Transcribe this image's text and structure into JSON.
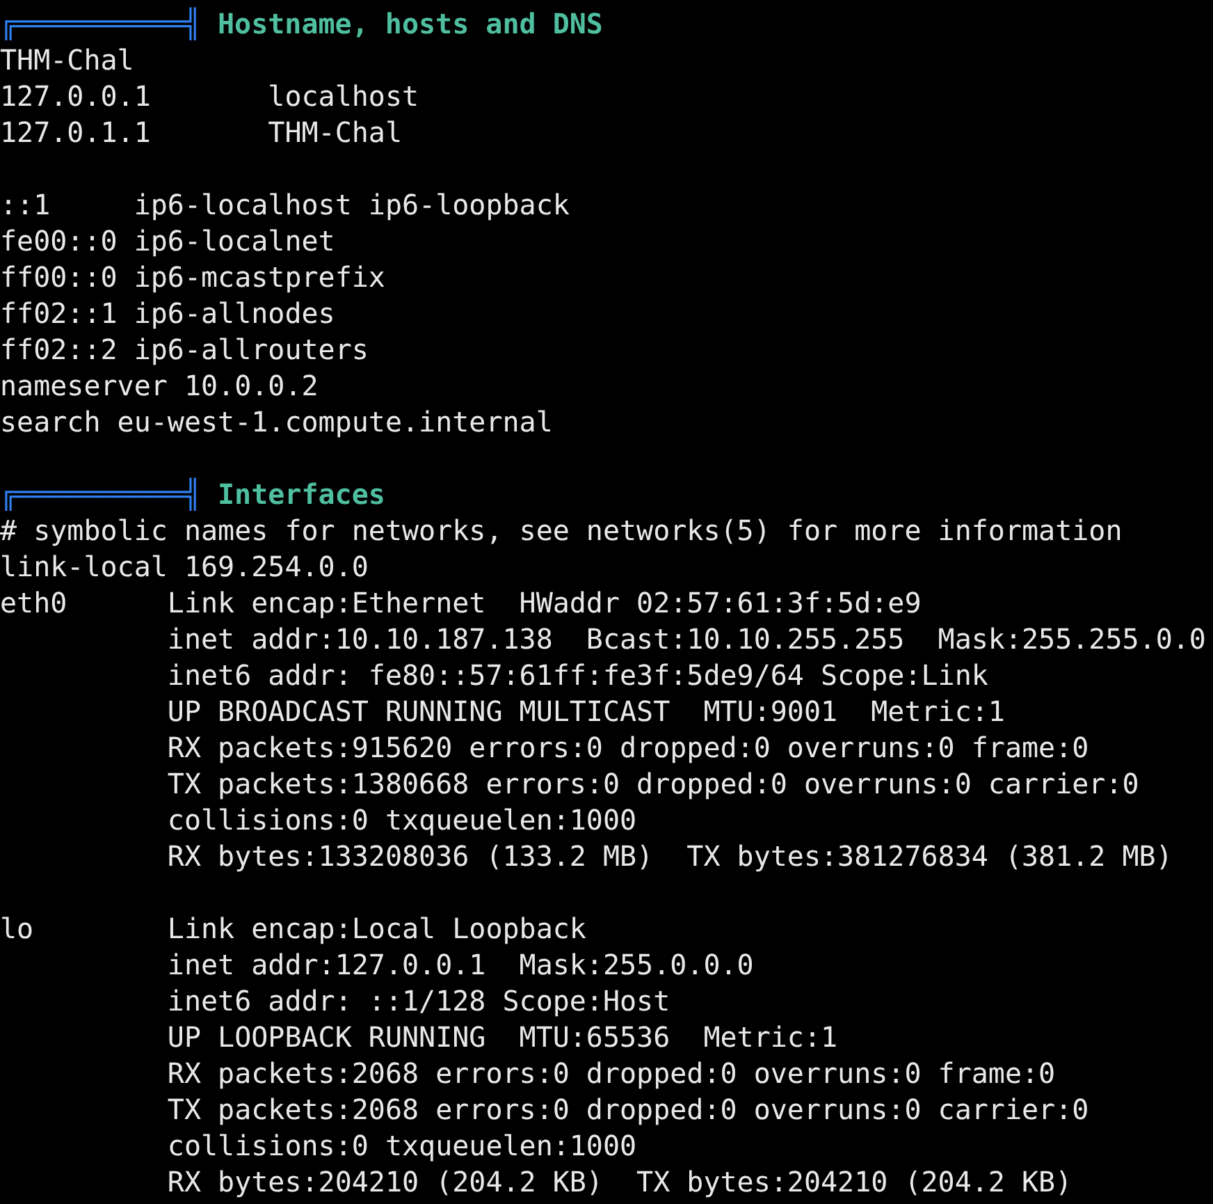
{
  "sections": [
    {
      "rule": "╔══════════╣",
      "title": "Hostname, hosts and DNS",
      "blocks": [
        [
          "THM-Chal",
          "127.0.0.1       localhost",
          "127.0.1.1       THM-Chal"
        ],
        [
          "::1     ip6-localhost ip6-loopback",
          "fe00::0 ip6-localnet",
          "ff00::0 ip6-mcastprefix",
          "ff02::1 ip6-allnodes",
          "ff02::2 ip6-allrouters",
          "nameserver 10.0.0.2",
          "search eu-west-1.compute.internal"
        ]
      ]
    },
    {
      "rule": "╔══════════╣",
      "title": "Interfaces",
      "blocks": [
        [
          "# symbolic names for networks, see networks(5) for more information",
          "link-local 169.254.0.0",
          "eth0      Link encap:Ethernet  HWaddr 02:57:61:3f:5d:e9",
          "          inet addr:10.10.187.138  Bcast:10.10.255.255  Mask:255.255.0.0",
          "          inet6 addr: fe80::57:61ff:fe3f:5de9/64 Scope:Link",
          "          UP BROADCAST RUNNING MULTICAST  MTU:9001  Metric:1",
          "          RX packets:915620 errors:0 dropped:0 overruns:0 frame:0",
          "          TX packets:1380668 errors:0 dropped:0 overruns:0 carrier:0",
          "          collisions:0 txqueuelen:1000",
          "          RX bytes:133208036 (133.2 MB)  TX bytes:381276834 (381.2 MB)"
        ],
        [
          "lo        Link encap:Local Loopback",
          "          inet addr:127.0.0.1  Mask:255.0.0.0",
          "          inet6 addr: ::1/128 Scope:Host",
          "          UP LOOPBACK RUNNING  MTU:65536  Metric:1",
          "          RX packets:2068 errors:0 dropped:0 overruns:0 frame:0",
          "          TX packets:2068 errors:0 dropped:0 overruns:0 carrier:0",
          "          collisions:0 txqueuelen:1000",
          "          RX bytes:204210 (204.2 KB)  TX bytes:204210 (204.2 KB)"
        ]
      ]
    }
  ]
}
